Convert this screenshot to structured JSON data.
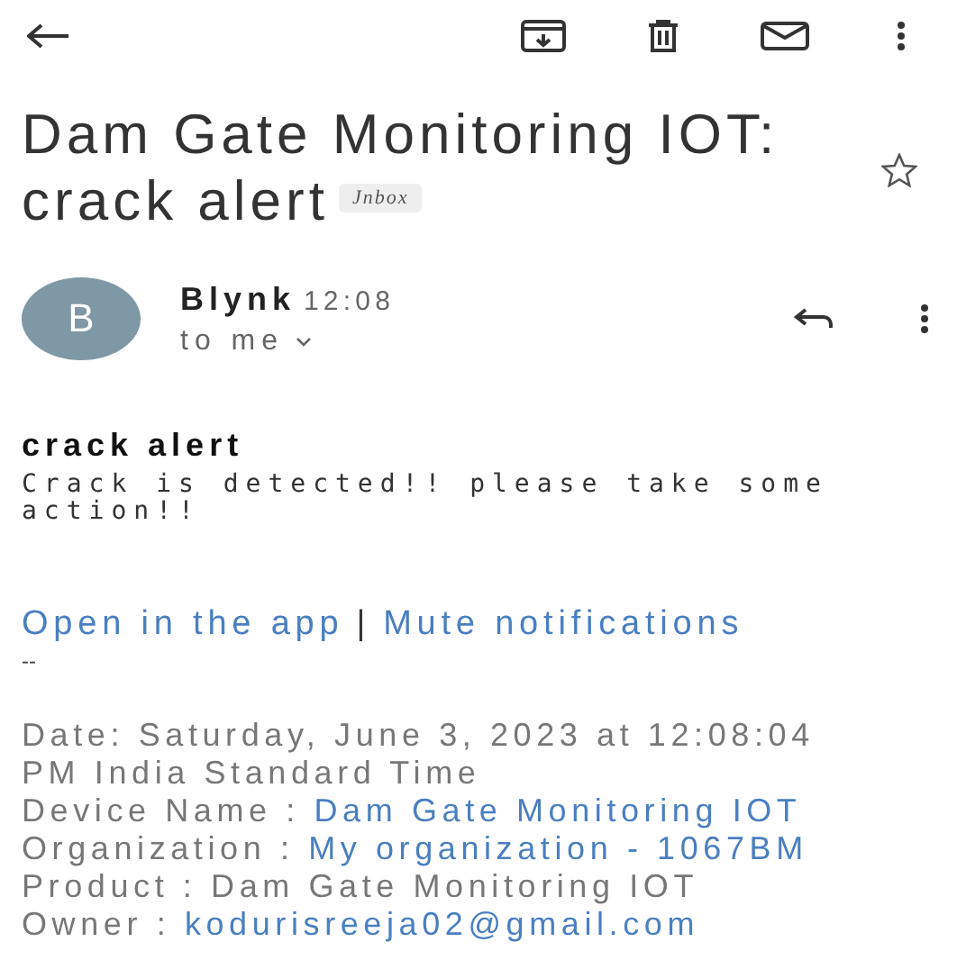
{
  "subject": {
    "title": "Dam Gate Monitoring IOT: crack alert",
    "label": "Jnbox",
    "starred": false
  },
  "sender": {
    "initial": "B",
    "name": "Blynk",
    "time": "12:08",
    "recipient": "to me"
  },
  "body": {
    "heading": "crack alert",
    "message": "Crack is detected!! please take some action!!",
    "links": [
      "Open in the app",
      "Mute notifications"
    ],
    "separator": "|",
    "signature_dash": "--",
    "details": [
      {
        "text": "Date: Saturday, June 3, 2023 at 12:08:04 PM India Standard Time",
        "kind": "plain"
      },
      {
        "label": "Device Name :",
        "value": "Dam Gate Monitoring IOT",
        "kind": "link"
      },
      {
        "label": "Organization :",
        "value": "My organization - 1067BM",
        "kind": "link"
      },
      {
        "text": "Product : Dam Gate Monitoring IOT",
        "kind": "plain"
      },
      {
        "label": "Owner :",
        "value": "kodurisreeja02@gmail.com",
        "kind": "link"
      }
    ]
  }
}
